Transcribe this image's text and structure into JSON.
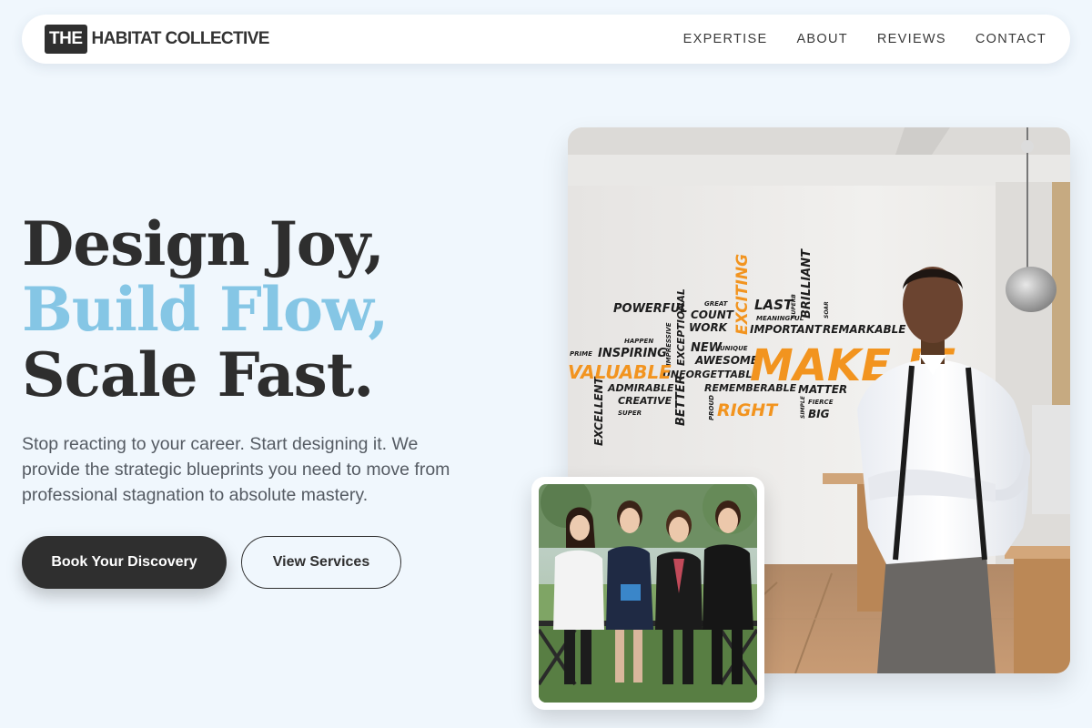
{
  "brand": {
    "mark": "THE",
    "name": "HABITAT COLLECTIVE"
  },
  "nav": {
    "items": [
      "EXPERTISE",
      "ABOUT",
      "REVIEWS",
      "CONTACT"
    ]
  },
  "hero": {
    "line1": "Design Joy,",
    "line2": "Build Flow,",
    "line3": "Scale Fast.",
    "subtext": "Stop reacting to your career. Start designing it. We provide the strategic blueprints you need to move from professional stagnation to absolute mastery.",
    "primary_cta": "Book Your Discovery",
    "secondary_cta": "View Services"
  },
  "wall_words": {
    "dark": [
      "POWERFUL",
      "GREAT",
      "COUNT",
      "WORK",
      "LAST",
      "MEANINGFUL",
      "IMPORTANT",
      "SUPERB",
      "BRILLIANT",
      "SOAR",
      "REMARKABLE",
      "HAPPEN",
      "PRIME",
      "INSPIRING",
      "IMPRESSIVE",
      "EXCEPTIONAL",
      "NEW",
      "UNIQUE",
      "AWESOME",
      "UNFORGETTABLE",
      "ADMIRABLE",
      "CREATIVE",
      "SUPER",
      "EXCELLENT",
      "BETTER",
      "PROUD",
      "REMEMBERABLE",
      "MATTER",
      "SIMPLE",
      "FIERCE",
      "BIG"
    ],
    "orange": [
      "EXCITING",
      "MAKE IT",
      "VALUABLE",
      "RIGHT"
    ]
  },
  "colors": {
    "accent": "#85c6e5",
    "dark": "#2f2f2f",
    "background": "#f0f7fd",
    "wall_orange": "#f2941f"
  }
}
